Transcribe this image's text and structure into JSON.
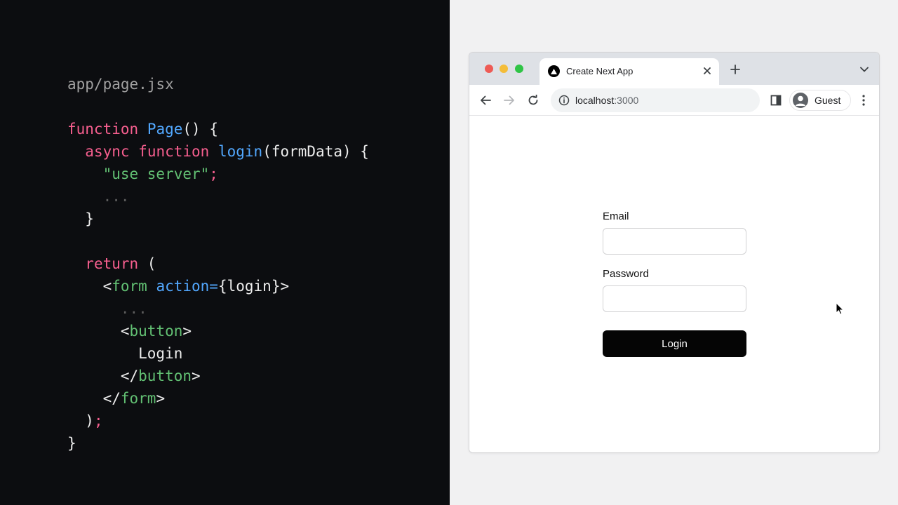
{
  "code": {
    "filename": "app/page.jsx",
    "l1": [
      "function",
      " ",
      "Page",
      "() {"
    ],
    "l2": [
      "  ",
      "async",
      " ",
      "function",
      " ",
      "login",
      "(formData) {"
    ],
    "l3": [
      "    ",
      "\"use server\"",
      ";"
    ],
    "l4": [
      "    ",
      "..."
    ],
    "l5": [
      "  }"
    ],
    "l7": [
      "  ",
      "return",
      " ("
    ],
    "l8": [
      "    <",
      "form",
      " ",
      "action=",
      "{login}>"
    ],
    "l9": [
      "      ",
      "..."
    ],
    "l10": [
      "      <",
      "button",
      ">"
    ],
    "l11": [
      "        Login"
    ],
    "l12": [
      "      </",
      "button",
      ">"
    ],
    "l13": [
      "    </",
      "form",
      ">"
    ],
    "l14": [
      "  )",
      ";"
    ],
    "l15": [
      "}"
    ]
  },
  "browser": {
    "tab_title": "Create Next App",
    "url_host": "localhost",
    "url_port": ":3000",
    "profile_label": "Guest",
    "icons": {
      "tab": "nextjs-logo-icon",
      "close": "close-icon",
      "new_tab": "plus-icon",
      "tab_search": "chevron-down-icon",
      "back": "arrow-left-icon",
      "forward": "arrow-right-icon",
      "reload": "reload-icon",
      "site_info": "info-icon",
      "side_panel": "side-panel-icon",
      "avatar": "user-avatar-icon",
      "menu": "kebab-menu-icon",
      "pointer": "mouse-pointer-icon"
    }
  },
  "form": {
    "email_label": "Email",
    "email_value": "",
    "password_label": "Password",
    "password_value": "",
    "login_label": "Login"
  },
  "colors": {
    "code_background": "#0c0d10",
    "keyword": "#f75f8f",
    "function_name": "#52a8ff",
    "string_and_tag": "#62c073",
    "button_background": "#050505"
  }
}
